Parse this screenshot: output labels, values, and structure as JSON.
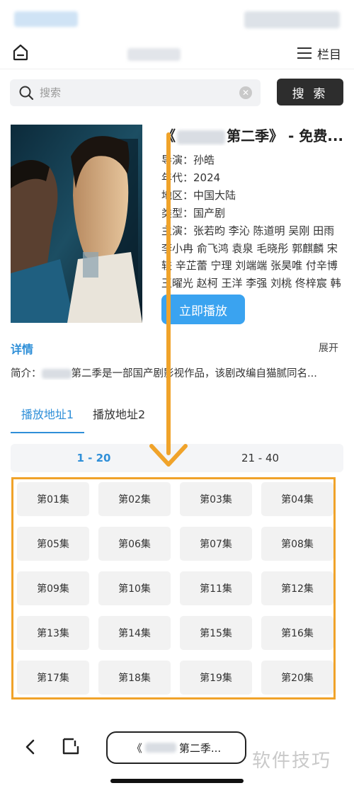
{
  "header": {
    "menu_label": "栏目"
  },
  "search": {
    "placeholder": "搜索",
    "button_label": "搜 索"
  },
  "video": {
    "title_prefix": "《",
    "title_suffix": "第二季》 - 免费...",
    "director": "导演：孙皓",
    "year": "年代：2024",
    "region": "地区：中国大陆",
    "genre": "类型：国产剧",
    "cast": "主演：张若昀 李沁 陈道明 吴刚 田雨 李小冉 俞飞鸿 袁泉 毛晓彤 郭麒麟 宋轶 辛芷蕾 宁理 刘端端 张昊唯 付辛博 王曜光 赵柯 王洋 李强 刘桃 佟梓宸 韩",
    "play_label": "立即播放"
  },
  "details": {
    "label": "详情",
    "expand_label": "展开",
    "synopsis_prefix": "简介：",
    "synopsis_suffix": "第二季是一部国产剧影视作品，该剧改编自猫腻同名..."
  },
  "sources": [
    "播放地址1",
    "播放地址2"
  ],
  "ranges": [
    "1 - 20",
    "21 - 40"
  ],
  "episodes": [
    "第01集",
    "第02集",
    "第03集",
    "第04集",
    "第05集",
    "第06集",
    "第07集",
    "第08集",
    "第09集",
    "第10集",
    "第11集",
    "第12集",
    "第13集",
    "第14集",
    "第15集",
    "第16集",
    "第17集",
    "第18集",
    "第19集",
    "第20集"
  ],
  "bottom": {
    "address_prefix": "《",
    "address_suffix": "第二季..."
  },
  "watermark": "软件技巧",
  "colors": {
    "accent": "#2f8fd8",
    "play_button": "#3aa3f0",
    "highlight": "#f0a32a",
    "search_button": "#2d2d2d"
  }
}
